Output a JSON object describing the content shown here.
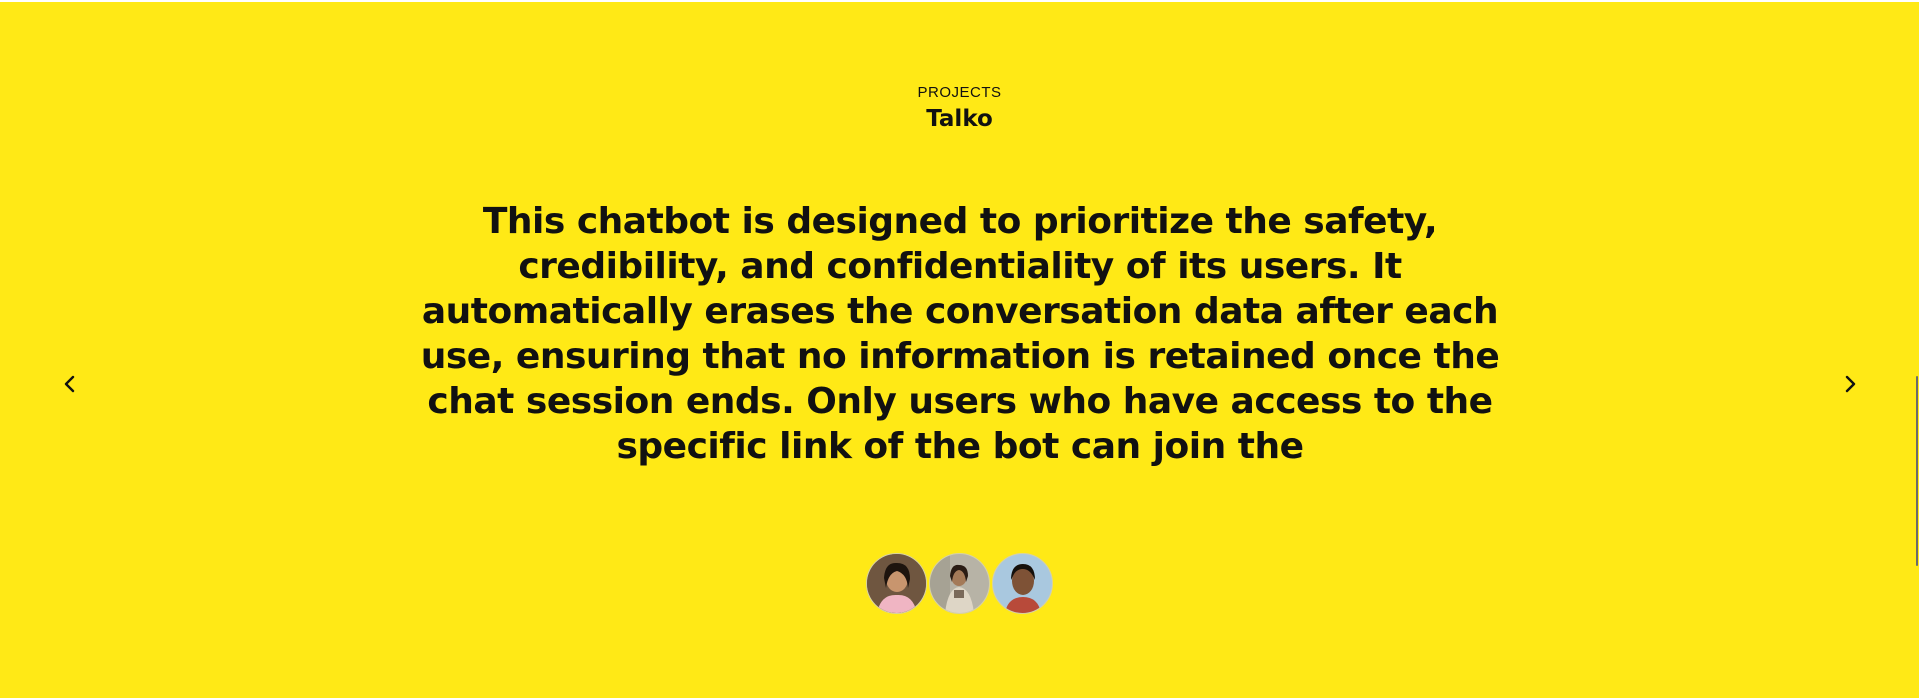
{
  "section": {
    "label": "PROJECTS",
    "title": "Talko"
  },
  "project": {
    "description": "This chatbot is designed to prioritize the safety, credibility, and confidentiality of its users. It automatically erases the conversation data after each use, ensuring that no information is retained once the chat session ends. Only users who have access to the specific link of the bot can join the"
  },
  "navigation": {
    "prev_icon": "chevron-left-icon",
    "next_icon": "chevron-right-icon"
  },
  "team": {
    "avatars": [
      {
        "name": "avatar-1"
      },
      {
        "name": "avatar-2"
      },
      {
        "name": "avatar-3"
      }
    ]
  },
  "colors": {
    "background": "#ffe916",
    "text": "#111111"
  }
}
